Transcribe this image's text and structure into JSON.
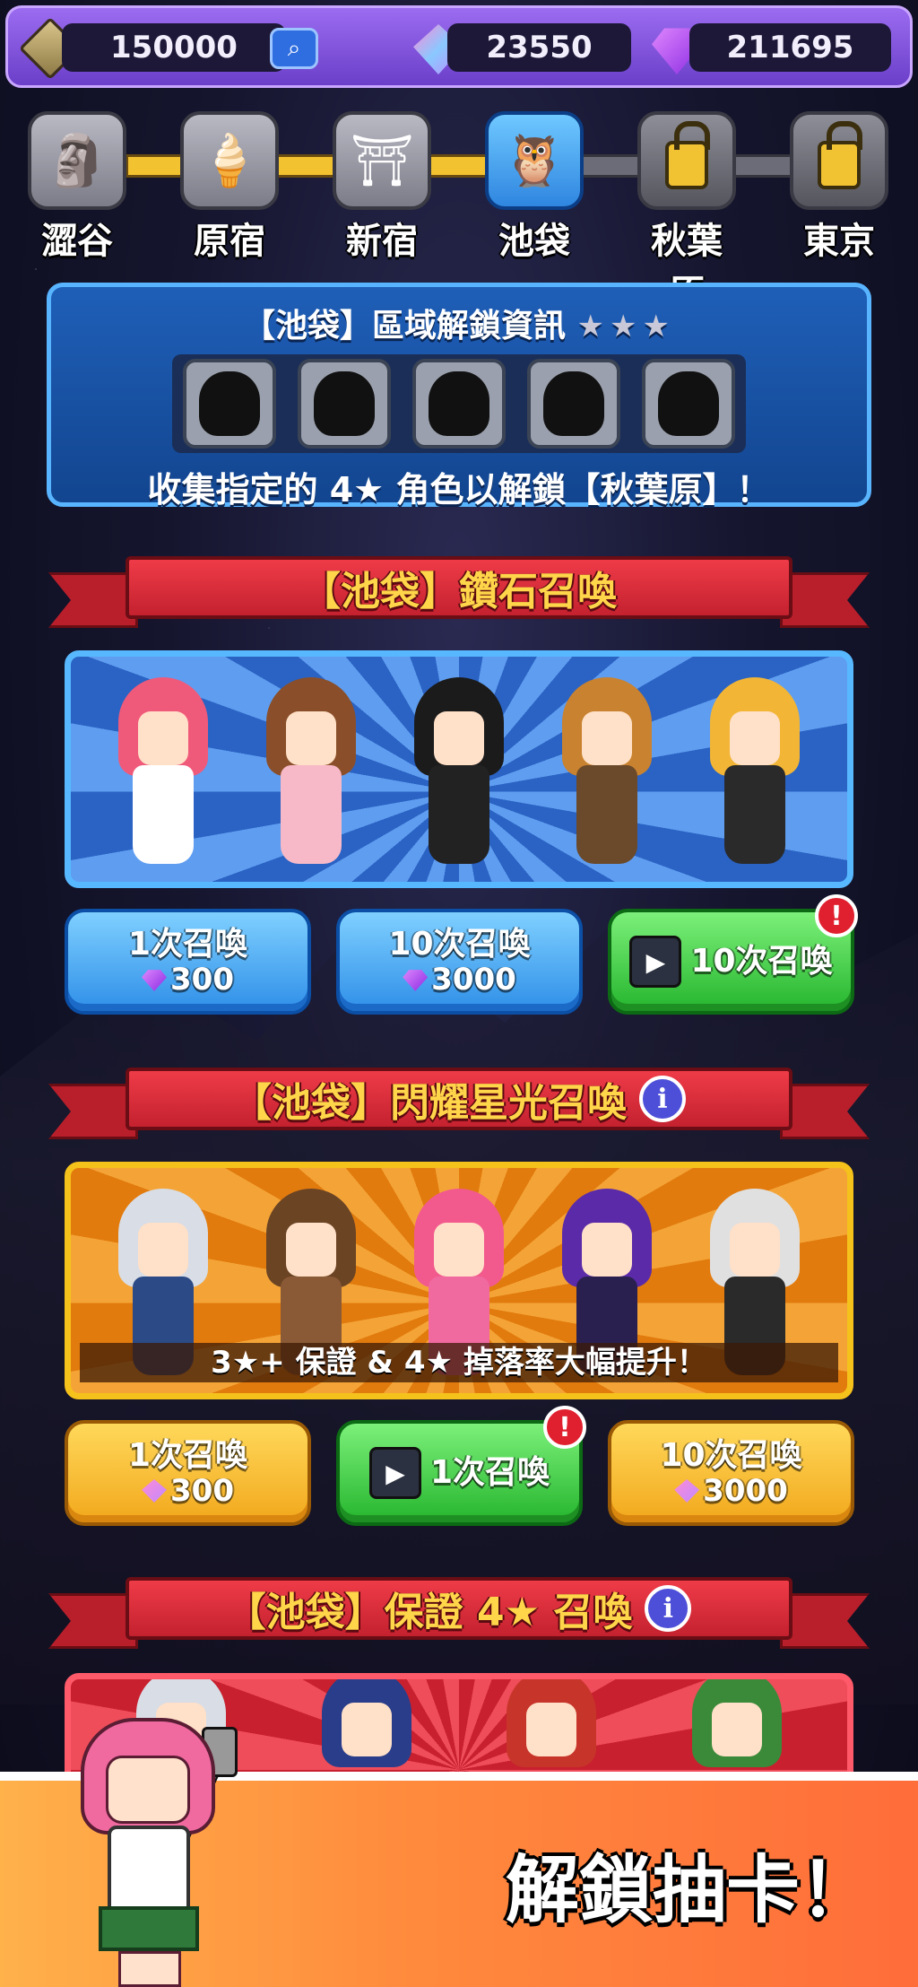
{
  "currency": {
    "coins": "150000",
    "pink_gems": "23550",
    "purple_gems": "211695"
  },
  "areas": [
    {
      "name": "澀谷",
      "icon": "statue-icon",
      "state": "unlocked"
    },
    {
      "name": "原宿",
      "icon": "crepe-icon",
      "state": "unlocked"
    },
    {
      "name": "新宿",
      "icon": "shrine-icon",
      "state": "unlocked"
    },
    {
      "name": "池袋",
      "icon": "owl-icon",
      "state": "active"
    },
    {
      "name": "秋葉原",
      "icon": "lock-icon",
      "state": "locked"
    },
    {
      "name": "東京",
      "icon": "lock-icon",
      "state": "locked"
    }
  ],
  "unlock_info": {
    "title": "【池袋】區域解鎖資訊",
    "stars": "★★★",
    "description": "收集指定的 4★ 角色以解鎖【秋葉原】！"
  },
  "diamond_summon": {
    "title": "【池袋】鑽石召喚",
    "buttons": [
      {
        "label": "1次召喚",
        "price": "300",
        "currency": "purple-gem"
      },
      {
        "label": "10次召喚",
        "price": "3000",
        "currency": "purple-gem"
      },
      {
        "label": "10次召喚",
        "type": "video"
      }
    ]
  },
  "star_summon": {
    "title": "【池袋】閃耀星光召喚",
    "caption": "3★+ 保證 & 4★ 掉落率大幅提升！",
    "buttons": [
      {
        "label": "1次召喚",
        "price": "300",
        "currency": "pink-gem"
      },
      {
        "label": "1次召喚",
        "type": "video"
      },
      {
        "label": "10次召喚",
        "price": "3000",
        "currency": "pink-gem"
      }
    ]
  },
  "guarantee_summon": {
    "title": "【池袋】保證 4★ 召喚"
  },
  "promo": {
    "text": "解鎖抽卡！"
  },
  "colors": {
    "topbar": "#7a4ad8",
    "panel_blue": "#1f5fb8",
    "ribbon_red": "#d42a38",
    "ribbon_text": "#ffd54a",
    "btn_blue": "#2f8fe8",
    "btn_yellow": "#f2a81c",
    "btn_green": "#25b52d"
  }
}
